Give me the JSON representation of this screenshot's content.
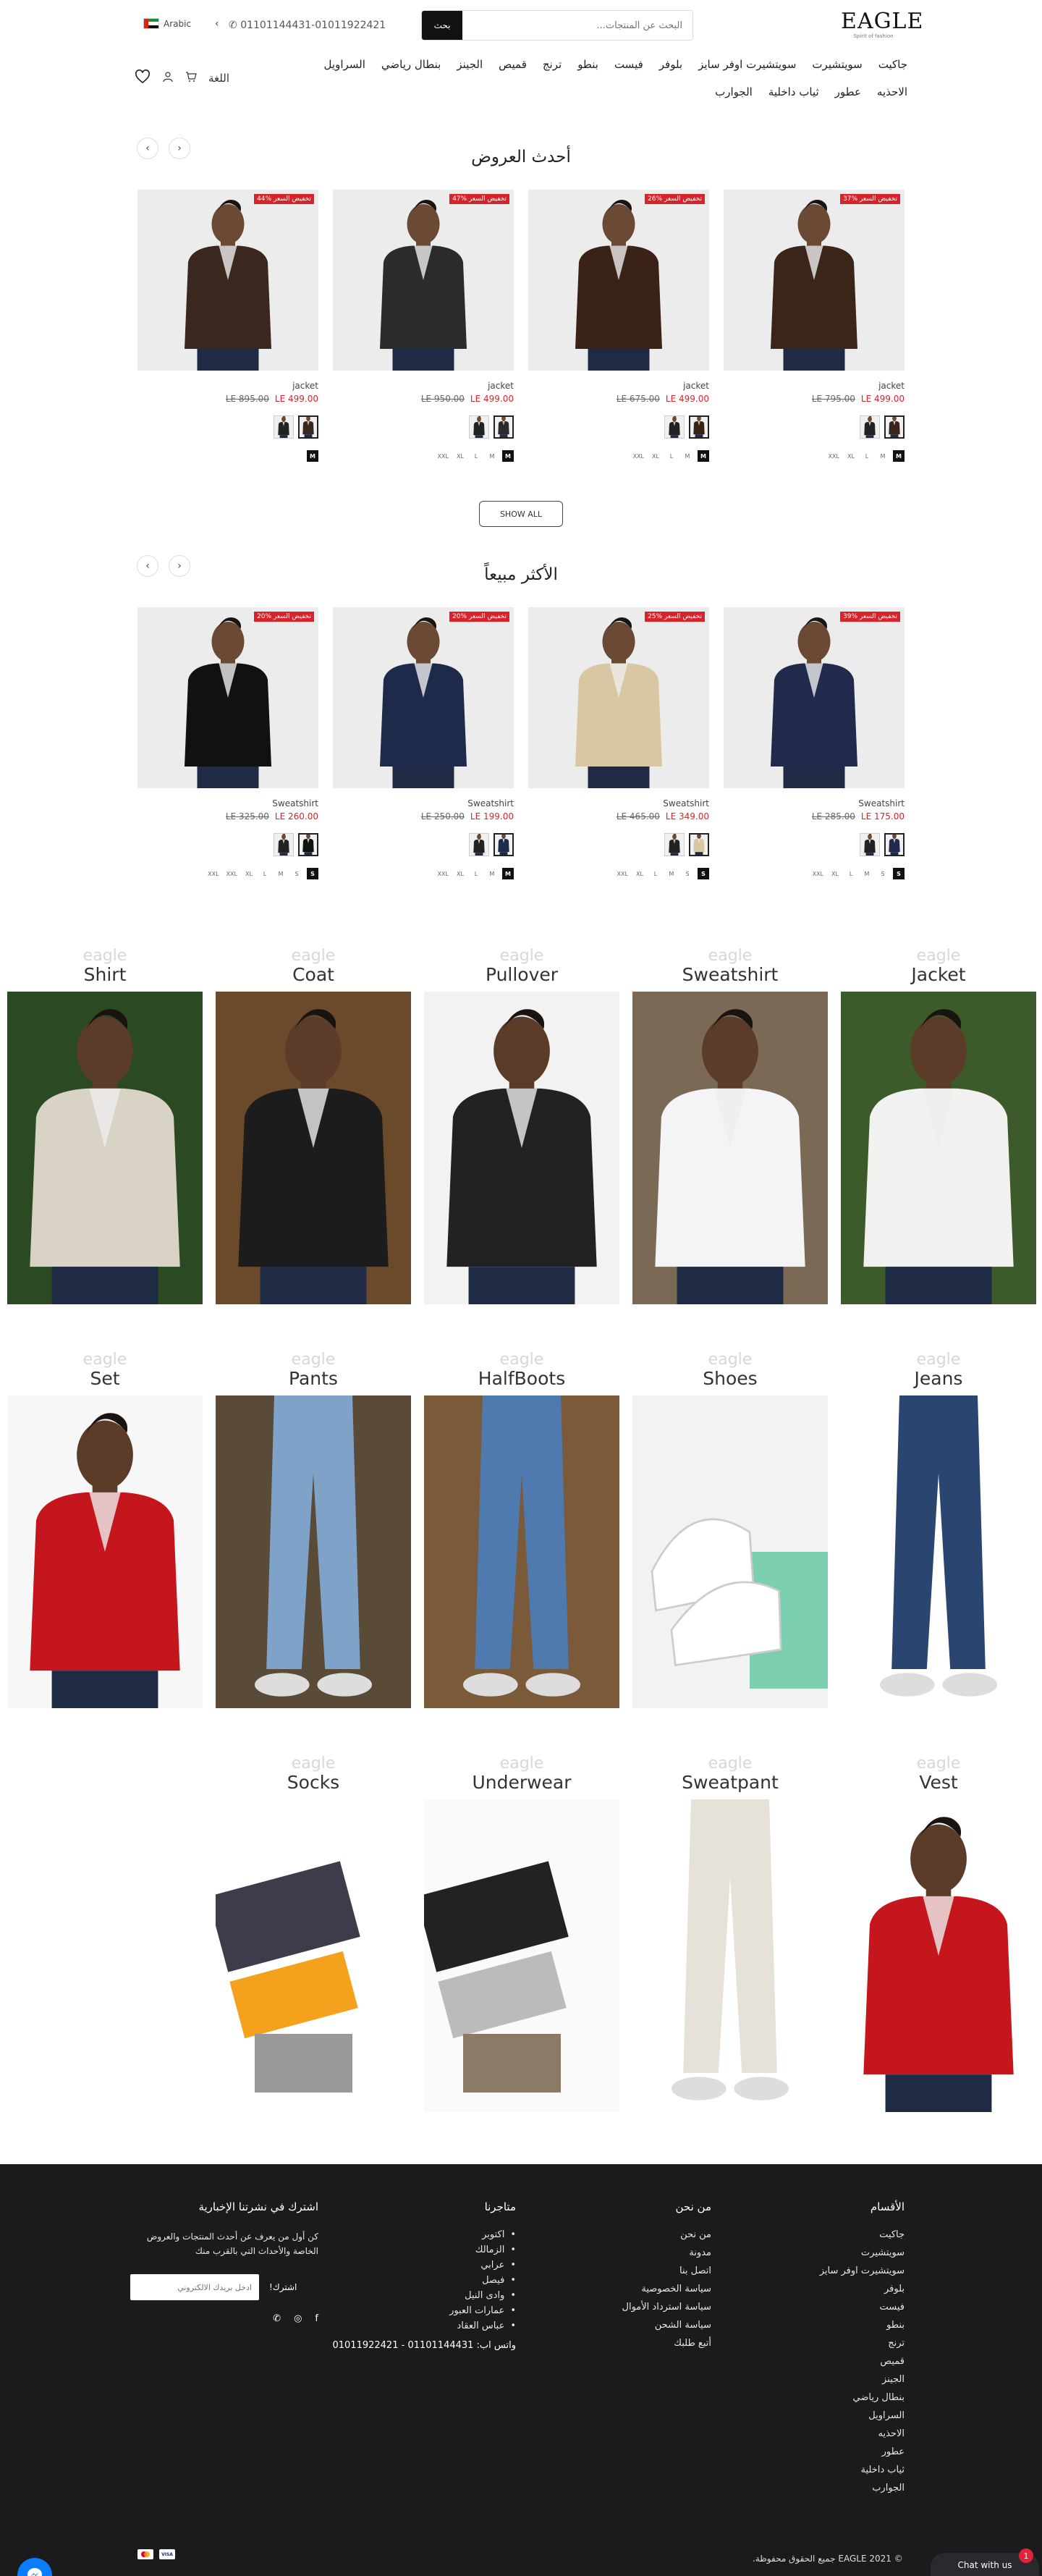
{
  "header": {
    "logo_text": "EAGLE",
    "logo_tagline": "Spirit of fashion",
    "search_placeholder": "البحث عن المنتجات...",
    "search_button": "بحث",
    "phone": "01101144431-01011922421",
    "language": "Arabic",
    "language_menu_label": "اللغة"
  },
  "menu": [
    "جاكيت",
    "سويتشيرت",
    "سويتشيرت اوفر سايز",
    "بلوفر",
    "فيست",
    "بنطو",
    "ترنج",
    "قميص",
    "الجينز",
    "بنطال رياضي",
    "السراويل",
    "الاحذيه",
    "عطور",
    "ثياب داخلية",
    "الجوارب"
  ],
  "latest": {
    "title": "أحدث العروض",
    "show_all": "SHOW ALL",
    "products": [
      {
        "badge": "تخفيض السعر %37",
        "name": "jacket",
        "old_price": "LE 795.00",
        "new_price": "LE 499.00",
        "sizes": [
          "XXL",
          "XL",
          "L",
          "M"
        ],
        "selected_size": "M",
        "color": "#3b2418"
      },
      {
        "badge": "تخفيض السعر %26",
        "name": "jacket",
        "old_price": "LE 675.00",
        "new_price": "LE 499.00",
        "sizes": [
          "XXL",
          "XL",
          "L",
          "M"
        ],
        "selected_size": "M",
        "color": "#3a2217"
      },
      {
        "badge": "تخفيض السعر %47",
        "name": "jacket",
        "old_price": "LE 950.00",
        "new_price": "LE 499.00",
        "sizes": [
          "XXL",
          "XL",
          "L",
          "M"
        ],
        "selected_size": "M",
        "color": "#2b2b2b"
      },
      {
        "badge": "تخفيض السعر %44",
        "name": "jacket",
        "old_price": "LE 895.00",
        "new_price": "LE 499.00",
        "sizes": [],
        "selected_size": "M",
        "color": "#3a271d"
      }
    ]
  },
  "best": {
    "title": "الأكثر مبيعاً",
    "products": [
      {
        "badge": "تخفيض السعر %39",
        "name": "Sweatshirt",
        "old_price": "LE 285.00",
        "new_price": "LE 175.00",
        "sizes": [
          "XXL",
          "XL",
          "L",
          "M",
          "S"
        ],
        "selected_size": "S",
        "color": "#1f2a4d"
      },
      {
        "badge": "تخفيض السعر %25",
        "name": "Sweatshirt",
        "old_price": "LE 465.00",
        "new_price": "LE 349.00",
        "sizes": [
          "XXL",
          "XL",
          "L",
          "M",
          "S"
        ],
        "selected_size": "S",
        "color": "#d9c6a2"
      },
      {
        "badge": "تخفيض السعر %20",
        "name": "Sweatshirt",
        "old_price": "LE 250.00",
        "new_price": "LE 199.00",
        "sizes": [
          "XXL",
          "XL",
          "L",
          "M"
        ],
        "selected_size": "M",
        "color": "#1d2a4a"
      },
      {
        "badge": "تخفيض السعر %20",
        "name": "Sweatshirt",
        "old_price": "LE 325.00",
        "new_price": "LE 260.00",
        "sizes": [
          "XXL",
          "XXL",
          "XL",
          "L",
          "M",
          "S"
        ],
        "selected_size": "S",
        "color": "#111111"
      }
    ]
  },
  "categories": {
    "watermark": "eagle",
    "row1": [
      "Shirt",
      "Coat",
      "Pullover",
      "Sweatshirt",
      "Jacket"
    ],
    "row2": [
      "Set",
      "Pants",
      "HalfBoots",
      "Shoes",
      "Jeans"
    ],
    "row3": [
      "Socks",
      "Underwear",
      "Sweatpant",
      "Vest"
    ]
  },
  "footer": {
    "sections_title": "الأقسام",
    "sections": [
      "جاكيت",
      "سويتشيرت",
      "سويتشيرت اوفر سايز",
      "بلوفر",
      "فيست",
      "بنطو",
      "ترنج",
      "قميص",
      "الجينز",
      "بنطال رياضي",
      "السراويل",
      "الاحذيه",
      "عطور",
      "ثياب داخلية",
      "الجوارب"
    ],
    "about_title": "من نحن",
    "about": [
      "من نحن",
      "مدونة",
      "اتصل بنا",
      "سياسة الخصوصية",
      "سياسة استرداد الأموال",
      "سياسة الشحن",
      "أتبع طلبك"
    ],
    "stores_title": "متاجرنا",
    "stores": [
      "اكتوبر",
      "الزمالك",
      "عرابي",
      "فيصل",
      "وادى النيل",
      "عمارات العبور",
      "عباس العقاد"
    ],
    "whatsapp": "واتس اب: 01101144431 - 01011922421",
    "newsletter_title": "اشترك في نشرتنا الإخبارية",
    "newsletter_text": "كن أول من يعرف عن أحدث المنتجات والعروض الخاصة والأحداث التي بالقرب منك",
    "newsletter_placeholder": "ادخل بريدك الالكتروني",
    "newsletter_button": "اشترك!",
    "copyright": "© EAGLE 2021 جميع الحقوق محفوظة.",
    "chat_label": "Chat with us",
    "chat_count": "1"
  },
  "colors": {
    "sale_red": "#d8232a",
    "footer_bg": "#1b1b1d",
    "accent_black": "#111111"
  }
}
